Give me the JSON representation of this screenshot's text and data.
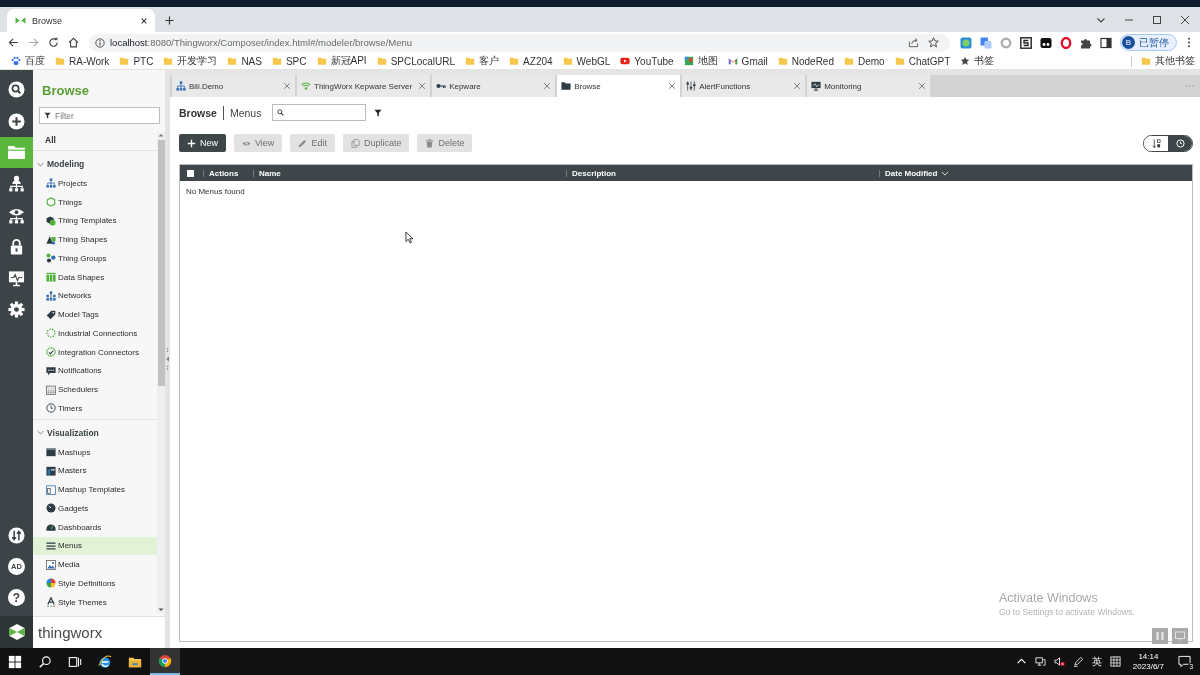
{
  "browser": {
    "tabs": [
      {
        "title": "Browse",
        "selected": true
      }
    ],
    "url": {
      "host": "localhost",
      "path": ":8080/Thingworx/Composer/index.html#/modeler/browse/Menu"
    },
    "profile": {
      "initial": "B",
      "status": "已暂停"
    },
    "bookmarks": [
      {
        "label": "百度",
        "kind": "paw"
      },
      {
        "label": "RA-Work",
        "kind": "folder"
      },
      {
        "label": "PTC",
        "kind": "folder"
      },
      {
        "label": "开发学习",
        "kind": "folder"
      },
      {
        "label": "NAS",
        "kind": "folder"
      },
      {
        "label": "SPC",
        "kind": "folder"
      },
      {
        "label": "新冠API",
        "kind": "folder"
      },
      {
        "label": "SPCLocalURL",
        "kind": "folder"
      },
      {
        "label": "客户",
        "kind": "folder"
      },
      {
        "label": "AZ204",
        "kind": "folder"
      },
      {
        "label": "WebGL",
        "kind": "folder"
      },
      {
        "label": "YouTube",
        "kind": "youtube"
      },
      {
        "label": "地图",
        "kind": "maps"
      },
      {
        "label": "Gmail",
        "kind": "gmail"
      },
      {
        "label": "NodeRed",
        "kind": "folder"
      },
      {
        "label": "Demo",
        "kind": "folder"
      },
      {
        "label": "ChatGPT",
        "kind": "folder"
      },
      {
        "label": "书签",
        "kind": "star"
      }
    ],
    "other_bookmarks": {
      "label": "其他书签",
      "kind": "folder"
    }
  },
  "rail": {
    "top": [
      {
        "kind": "search",
        "selected": false
      },
      {
        "kind": "create",
        "selected": false
      },
      {
        "kind": "browse",
        "selected": true
      },
      {
        "kind": "manage",
        "selected": false
      },
      {
        "kind": "monitor",
        "selected": false
      },
      {
        "kind": "security",
        "selected": false
      },
      {
        "kind": "system",
        "selected": false
      },
      {
        "kind": "settings",
        "selected": false
      }
    ],
    "bottom": [
      {
        "kind": "import",
        "selected": false
      },
      {
        "kind": "user",
        "label": "AD",
        "selected": false
      },
      {
        "kind": "help",
        "label": "?",
        "selected": false
      }
    ]
  },
  "sidebar": {
    "title": "Browse",
    "filter": {
      "placeholder": "Filter"
    },
    "all": {
      "label": "All",
      "selected": false
    },
    "sections": [
      {
        "title": "Modeling",
        "expanded": true,
        "items": [
          {
            "label": "Projects",
            "kind": "projects",
            "selected": false
          },
          {
            "label": "Things",
            "kind": "things",
            "selected": false
          },
          {
            "label": "Thing Templates",
            "kind": "thing_templates",
            "selected": false
          },
          {
            "label": "Thing Shapes",
            "kind": "thing_shapes",
            "selected": false
          },
          {
            "label": "Thing Groups",
            "kind": "thing_groups",
            "selected": false
          },
          {
            "label": "Data Shapes",
            "kind": "data_shapes",
            "selected": false
          },
          {
            "label": "Networks",
            "kind": "networks",
            "selected": false
          },
          {
            "label": "Model Tags",
            "kind": "model_tags",
            "selected": false
          },
          {
            "label": "Industrial Connections",
            "kind": "industrial_connections",
            "selected": false
          },
          {
            "label": "Integration Connectors",
            "kind": "integration_connectors",
            "selected": false
          },
          {
            "label": "Notifications",
            "kind": "notifications",
            "selected": false
          },
          {
            "label": "Schedulers",
            "kind": "schedulers",
            "selected": false
          },
          {
            "label": "Timers",
            "kind": "timers",
            "selected": false
          }
        ]
      },
      {
        "title": "Visualization",
        "expanded": true,
        "items": [
          {
            "label": "Mashups",
            "kind": "mashups",
            "selected": false
          },
          {
            "label": "Masters",
            "kind": "masters",
            "selected": false
          },
          {
            "label": "Mashup Templates",
            "kind": "mashup_templates",
            "selected": false
          },
          {
            "label": "Gadgets",
            "kind": "gadgets",
            "selected": false
          },
          {
            "label": "Dashboards",
            "kind": "dashboards",
            "selected": false
          },
          {
            "label": "Menus",
            "kind": "menus",
            "selected": true
          },
          {
            "label": "Media",
            "kind": "media",
            "selected": false
          },
          {
            "label": "Style Definitions",
            "kind": "style_definitions",
            "selected": false
          },
          {
            "label": "Style Themes",
            "kind": "style_themes",
            "selected": false
          }
        ]
      }
    ],
    "brand": "thingworx"
  },
  "main": {
    "tabs": [
      {
        "label": "Bili.Demo",
        "kind": "project",
        "selected": false
      },
      {
        "label": "ThingWorx Kepware Server",
        "kind": "connection",
        "selected": false
      },
      {
        "label": "Kepware",
        "kind": "key",
        "selected": false
      },
      {
        "label": "Browse",
        "kind": "folder",
        "selected": true
      },
      {
        "label": "AlertFunctions",
        "kind": "sliders",
        "selected": false
      },
      {
        "label": "Monitoring",
        "kind": "monitor",
        "selected": false
      }
    ],
    "breadcrumb": {
      "root": "Browse",
      "current": "Menus"
    },
    "actions": [
      {
        "label": "New",
        "kind": "add",
        "disabled": false
      },
      {
        "label": "View",
        "kind": "view",
        "disabled": true
      },
      {
        "label": "Edit",
        "kind": "edit",
        "disabled": true
      },
      {
        "label": "Duplicate",
        "kind": "duplicate",
        "disabled": true
      },
      {
        "label": "Delete",
        "kind": "delete",
        "disabled": true
      }
    ],
    "view_toggle": [
      {
        "kind": "sort",
        "selected": false
      },
      {
        "kind": "recent",
        "selected": true
      }
    ],
    "table": {
      "select_all": {
        "checked": false
      },
      "columns": [
        {
          "label": "Actions",
          "sorted": false
        },
        {
          "label": "Name",
          "sorted": false
        },
        {
          "label": "Description",
          "sorted": false
        },
        {
          "label": "Date Modified",
          "sorted": true
        }
      ],
      "empty_message": "No Menus found"
    }
  },
  "taskbar": {
    "apps": [
      {
        "kind": "start",
        "active": false
      },
      {
        "kind": "search",
        "active": false
      },
      {
        "kind": "task_view",
        "active": false
      },
      {
        "kind": "ie",
        "active": false
      },
      {
        "kind": "explorer",
        "active": false
      },
      {
        "kind": "chrome",
        "active": true
      }
    ],
    "tray": {
      "ime": "英",
      "time": "14:14",
      "date": "2023/6/7",
      "notifications": "3"
    }
  },
  "activation_notice": {
    "title": "Activate Windows",
    "message": "Go to Settings to activate Windows."
  }
}
